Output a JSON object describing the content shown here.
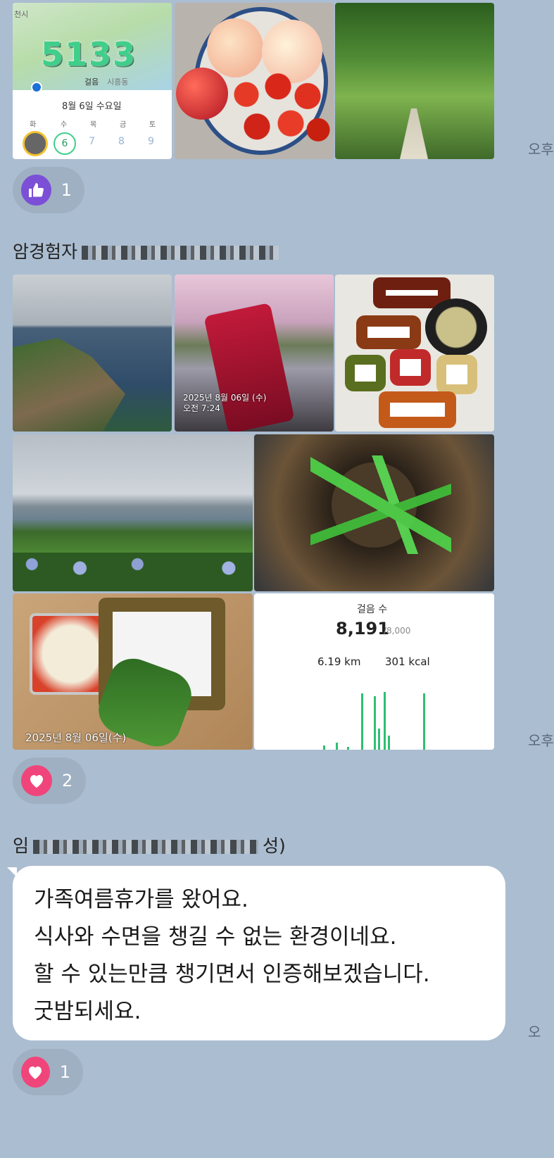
{
  "message1": {
    "step_card": {
      "steps": "5133",
      "place_left": "천시",
      "place_mid": "시",
      "mode": "걸음",
      "district": "시흥동",
      "date": "8월 6일 수요일",
      "weekdays": [
        "화",
        "수",
        "목",
        "금",
        "토"
      ],
      "days": [
        "",
        "6",
        "7",
        "8",
        "9"
      ]
    },
    "time": "오후",
    "reaction": {
      "icon": "thumbs-up",
      "count": "1"
    }
  },
  "message2": {
    "sender": "암경험자",
    "photo_stamp_date": "2025년 8월 06일 (수)",
    "photo_stamp_time": "오전 7:24",
    "photo_stamp_date2": "2025년 8월 06일(수)",
    "steps_card": {
      "title": "걸음 수",
      "value": "8,191",
      "goal": "/8,000",
      "distance": "6.19 km",
      "calories": "301 kcal"
    },
    "time": "오후",
    "reaction": {
      "icon": "heart",
      "count": "2"
    }
  },
  "message3": {
    "sender_prefix": "임",
    "sender_suffix": "성)",
    "lines": [
      "가족여름휴가를 왔어요.",
      "식사와 수면을 챙길 수 없는 환경이네요.",
      "할 수 있는만큼 챙기면서 인증해보겠습니다.",
      "굿밤되세요."
    ],
    "time": "오",
    "reaction": {
      "icon": "heart",
      "count": "1"
    }
  },
  "colors": {
    "background": "#abbdd0",
    "reaction_pill": "#9fb0c2",
    "thumb_purple": "#7b4fd6",
    "heart_pink": "#f0457a",
    "step_green": "#2fbf72"
  }
}
